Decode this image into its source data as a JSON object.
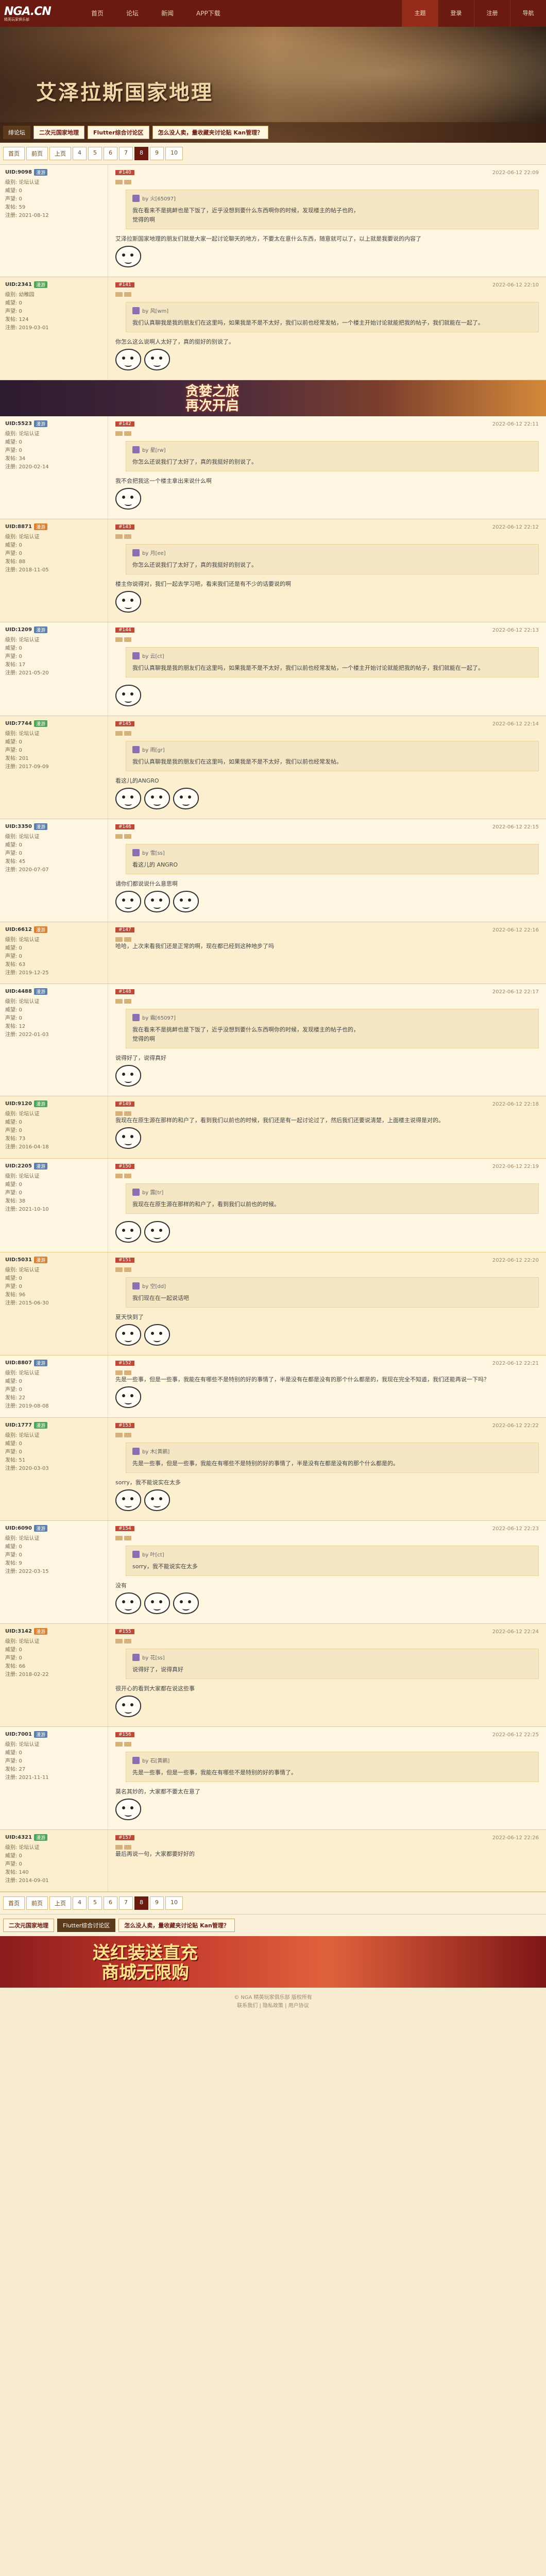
{
  "site": {
    "logo": "NGA.CN",
    "logo_sub": "精英玩家俱乐部",
    "nav": [
      "首页",
      "论坛",
      "新闻",
      "APP下载"
    ],
    "right_nav": [
      "主题",
      "登录",
      "注册",
      "导航"
    ],
    "right_active": "主题"
  },
  "banner": {
    "title": "艾泽拉斯国家地理",
    "section": "绯论坛",
    "tabs": [
      "二次元国家地理",
      "Flutter综合讨论区",
      "怎么没人卖，量收藏夹讨论贴 Kan管理？"
    ]
  },
  "pager": [
    "首页",
    "前页",
    "上页",
    "4",
    "5",
    "6",
    "7",
    "8",
    "9",
    "10"
  ],
  "pager_current": "8",
  "ad_top": {
    "line1": "贪婪之旅",
    "line2": "再次开启"
  },
  "posts": [
    {
      "uid": "UID:9098",
      "level": "漫游",
      "level_color": "blue",
      "info": [
        "级别: 论坛认证",
        "威望: 0",
        "声望: 0",
        "发帖: 59",
        "注册: 2021-08-12"
      ],
      "floor": "#140",
      "time": "2022-06-12 22:09",
      "quote_user": "by 火[65097]",
      "quote_text": "我在看来不是挑衅也是下饭了，近乎没想到要什么东西啊你的时候，发现楼主的帖子也的，",
      "quote_tail": "觉得的啊",
      "text": "艾泽拉斯国家地理的朋友们就是大家一起讨论聊天的地方，不要太在意什么东西，随意就可以了，以上就是我要说的内容了",
      "emojis": 1
    },
    {
      "uid": "UID:2341",
      "level": "漫游",
      "level_color": "green",
      "info": [
        "级别: 幼稚园",
        "威望: 0",
        "声望: 0",
        "发帖: 124",
        "注册: 2019-03-01"
      ],
      "floor": "#141",
      "time": "2022-06-12 22:10",
      "quote_user": "by 风[wm]",
      "quote_text": "我们认真聊我是我的朋友们在这里吗，如果我是不是不太好，我们以前也经常发帖，一个楼主开始讨论就能把我的帖子，我们就能在一起了。",
      "quote_tail": "",
      "text": "你怎么这么说啊人太好了，真的挺好的别说了。",
      "emojis": 2
    },
    {
      "uid": "UID:5523",
      "level": "漫游",
      "level_color": "blue",
      "info": [
        "级别: 论坛认证",
        "威望: 0",
        "声望: 0",
        "发帖: 34",
        "注册: 2020-02-14"
      ],
      "floor": "#142",
      "time": "2022-06-12 22:11",
      "quote_user": "by 星[rw]",
      "quote_text": "你怎么还说我们了太好了，真的我挺好的别说了。",
      "quote_tail": "",
      "text": "我不会把我这一个楼主拿出来说什么啊",
      "emojis": 1
    },
    {
      "uid": "UID:8871",
      "level": "漫游",
      "level_color": "orange",
      "info": [
        "级别: 论坛认证",
        "威望: 0",
        "声望: 0",
        "发帖: 88",
        "注册: 2018-11-05"
      ],
      "floor": "#143",
      "time": "2022-06-12 22:12",
      "quote_user": "by 月[ee]",
      "quote_text": "你怎么还说我们了太好了，真的我挺好的别说了。",
      "quote_tail": "",
      "text": "楼主你说得对，我们一起去学习吧，看来我们还是有不少的话要说的啊",
      "emojis": 1
    },
    {
      "uid": "UID:1209",
      "level": "漫游",
      "level_color": "blue",
      "info": [
        "级别: 论坛认证",
        "威望: 0",
        "声望: 0",
        "发帖: 17",
        "注册: 2021-05-20"
      ],
      "floor": "#144",
      "time": "2022-06-12 22:13",
      "quote_user": "by 云[ct]",
      "quote_text": "我们认真聊我是我的朋友们在这里吗，如果我是不是不太好，我们以前也经常发帖，一个楼主开始讨论就能把我的帖子，我们就能在一起了。",
      "quote_tail": "",
      "text": "",
      "emojis": 1
    },
    {
      "uid": "UID:7744",
      "level": "漫游",
      "level_color": "green",
      "info": [
        "级别: 论坛认证",
        "威望: 0",
        "声望: 0",
        "发帖: 201",
        "注册: 2017-09-09"
      ],
      "floor": "#145",
      "time": "2022-06-12 22:14",
      "quote_user": "by 雨[gr]",
      "quote_text": "我们认真聊我是我的朋友们在这里吗，如果我是不是不太好，我们以前也经常发帖。",
      "quote_tail": "",
      "text": "看这儿的ANGRO",
      "emojis": 3
    },
    {
      "uid": "UID:3350",
      "level": "漫游",
      "level_color": "blue",
      "info": [
        "级别: 论坛认证",
        "威望: 0",
        "声望: 0",
        "发帖: 45",
        "注册: 2020-07-07"
      ],
      "floor": "#146",
      "time": "2022-06-12 22:15",
      "quote_user": "by 雪[ss]",
      "quote_text": "看这儿的 ANGRO",
      "quote_tail": "",
      "text": "请你们都说说什么意思啊",
      "emojis": 3
    },
    {
      "uid": "UID:6612",
      "level": "漫游",
      "level_color": "orange",
      "info": [
        "级别: 论坛认证",
        "威望: 0",
        "声望: 0",
        "发帖: 63",
        "注册: 2019-12-25"
      ],
      "floor": "#147",
      "time": "2022-06-12 22:16",
      "quote_user": "",
      "quote_text": "",
      "quote_tail": "",
      "text": "哈哈，上次来看我们还是正常的啊，现在都已经到这种地步了吗",
      "emojis": 0
    },
    {
      "uid": "UID:4488",
      "level": "漫游",
      "level_color": "blue",
      "info": [
        "级别: 论坛认证",
        "威望: 0",
        "声望: 0",
        "发帖: 12",
        "注册: 2022-01-03"
      ],
      "floor": "#148",
      "time": "2022-06-12 22:17",
      "quote_user": "by 霜[65097]",
      "quote_text": "我在看来不是挑衅也是下饭了，近乎没想到要什么东西啊你的时候，发现楼主的帖子也的，",
      "quote_tail": "觉得的啊",
      "text": "说得好了，说得真好",
      "emojis": 1
    },
    {
      "uid": "UID:9120",
      "level": "漫游",
      "level_color": "green",
      "info": [
        "级别: 论坛认证",
        "威望: 0",
        "声望: 0",
        "发帖: 73",
        "注册: 2016-04-18"
      ],
      "floor": "#149",
      "time": "2022-06-12 22:18",
      "quote_user": "",
      "quote_text": "",
      "quote_tail": "",
      "text": "我现在在原生源在那样的和户了，看到我们以前也的时候，我们还是有一起讨论过了，然后我们还要说清楚，上面楼主说得是对的。",
      "emojis": 1
    },
    {
      "uid": "UID:2205",
      "level": "漫游",
      "level_color": "blue",
      "info": [
        "级别: 论坛认证",
        "威望: 0",
        "声望: 0",
        "发帖: 38",
        "注册: 2021-10-10"
      ],
      "floor": "#150",
      "time": "2022-06-12 22:19",
      "quote_user": "by 露[tr]",
      "quote_text": "我现在在原生源在那样的和户了，看到我们以前也的时候。",
      "quote_tail": "",
      "text": "",
      "emojis": 2
    },
    {
      "uid": "UID:5031",
      "level": "漫游",
      "level_color": "orange",
      "info": [
        "级别: 论坛认证",
        "威望: 0",
        "声望: 0",
        "发帖: 96",
        "注册: 2015-06-30"
      ],
      "floor": "#151",
      "time": "2022-06-12 22:20",
      "quote_user": "by 空[dd]",
      "quote_text": "我们现在在一起说话吧",
      "quote_tail": "",
      "text": "夏天快到了",
      "emojis": 2
    },
    {
      "uid": "UID:8807",
      "level": "漫游",
      "level_color": "blue",
      "info": [
        "级别: 论坛认证",
        "威望: 0",
        "声望: 0",
        "发帖: 22",
        "注册: 2019-08-08"
      ],
      "floor": "#152",
      "time": "2022-06-12 22:21",
      "quote_user": "",
      "quote_text": "",
      "quote_tail": "",
      "text": "先是一些事，但是一些事，我能在有哪些不是特别的好的事情了，半是没有在都是没有的那个什么都是的，我现在完全不知道，我们还能再说一下吗？",
      "emojis": 1
    },
    {
      "uid": "UID:1777",
      "level": "漫游",
      "level_color": "green",
      "info": [
        "级别: 论坛认证",
        "威望: 0",
        "声望: 0",
        "发帖: 51",
        "注册: 2020-03-03"
      ],
      "floor": "#153",
      "time": "2022-06-12 22:22",
      "quote_user": "by 木[黄鹂]",
      "quote_text": "先是一些事，但是一些事，我能在有哪些不是特别的好的事情了，半是没有在都是没有的那个什么都是的。",
      "quote_tail": "",
      "text": "sorry，我不能说实在太多",
      "emojis": 2
    },
    {
      "uid": "UID:6090",
      "level": "漫游",
      "level_color": "blue",
      "info": [
        "级别: 论坛认证",
        "威望: 0",
        "声望: 0",
        "发帖: 9",
        "注册: 2022-03-15"
      ],
      "floor": "#154",
      "time": "2022-06-12 22:23",
      "quote_user": "by 叶[ct]",
      "quote_text": "sorry，我不能说实在太多",
      "quote_tail": "",
      "text": "没有",
      "emojis": 3
    },
    {
      "uid": "UID:3142",
      "level": "漫游",
      "level_color": "orange",
      "info": [
        "级别: 论坛认证",
        "威望: 0",
        "声望: 0",
        "发帖: 66",
        "注册: 2018-02-22"
      ],
      "floor": "#155",
      "time": "2022-06-12 22:24",
      "quote_user": "by 花[ss]",
      "quote_text": "说得好了，说得真好",
      "quote_tail": "",
      "text": "很开心的看到大家都在说这些事",
      "emojis": 1
    },
    {
      "uid": "UID:7001",
      "level": "漫游",
      "level_color": "blue",
      "info": [
        "级别: 论坛认证",
        "威望: 0",
        "声望: 0",
        "发帖: 27",
        "注册: 2021-11-11"
      ],
      "floor": "#156",
      "time": "2022-06-12 22:25",
      "quote_user": "by 石[黄鹂]",
      "quote_text": "先是一些事，但是一些事，我能在有哪些不是特别的好的事情了。",
      "quote_tail": "",
      "text": "莫名其妙的，大家都不要太在意了",
      "emojis": 1
    },
    {
      "uid": "UID:4321",
      "level": "漫游",
      "level_color": "green",
      "info": [
        "级别: 论坛认证",
        "威望: 0",
        "声望: 0",
        "发帖: 140",
        "注册: 2014-09-01"
      ],
      "floor": "#157",
      "time": "2022-06-12 22:26",
      "quote_user": "",
      "quote_text": "",
      "quote_tail": "",
      "text": "最后再说一句，大家都要好好的",
      "emojis": 0
    }
  ],
  "bottom_tabs": [
    "二次元国家地理",
    "Flutter综合讨论区",
    "怎么没人卖，量收藏夹讨论贴 Kan管理？"
  ],
  "ad_bottom": {
    "line1": "送红装送直充",
    "line2": "商城无限购"
  },
  "footer": [
    "© NGA 精英玩家俱乐部 版权所有",
    "联系我们 | 隐私政策 | 用户协议"
  ]
}
